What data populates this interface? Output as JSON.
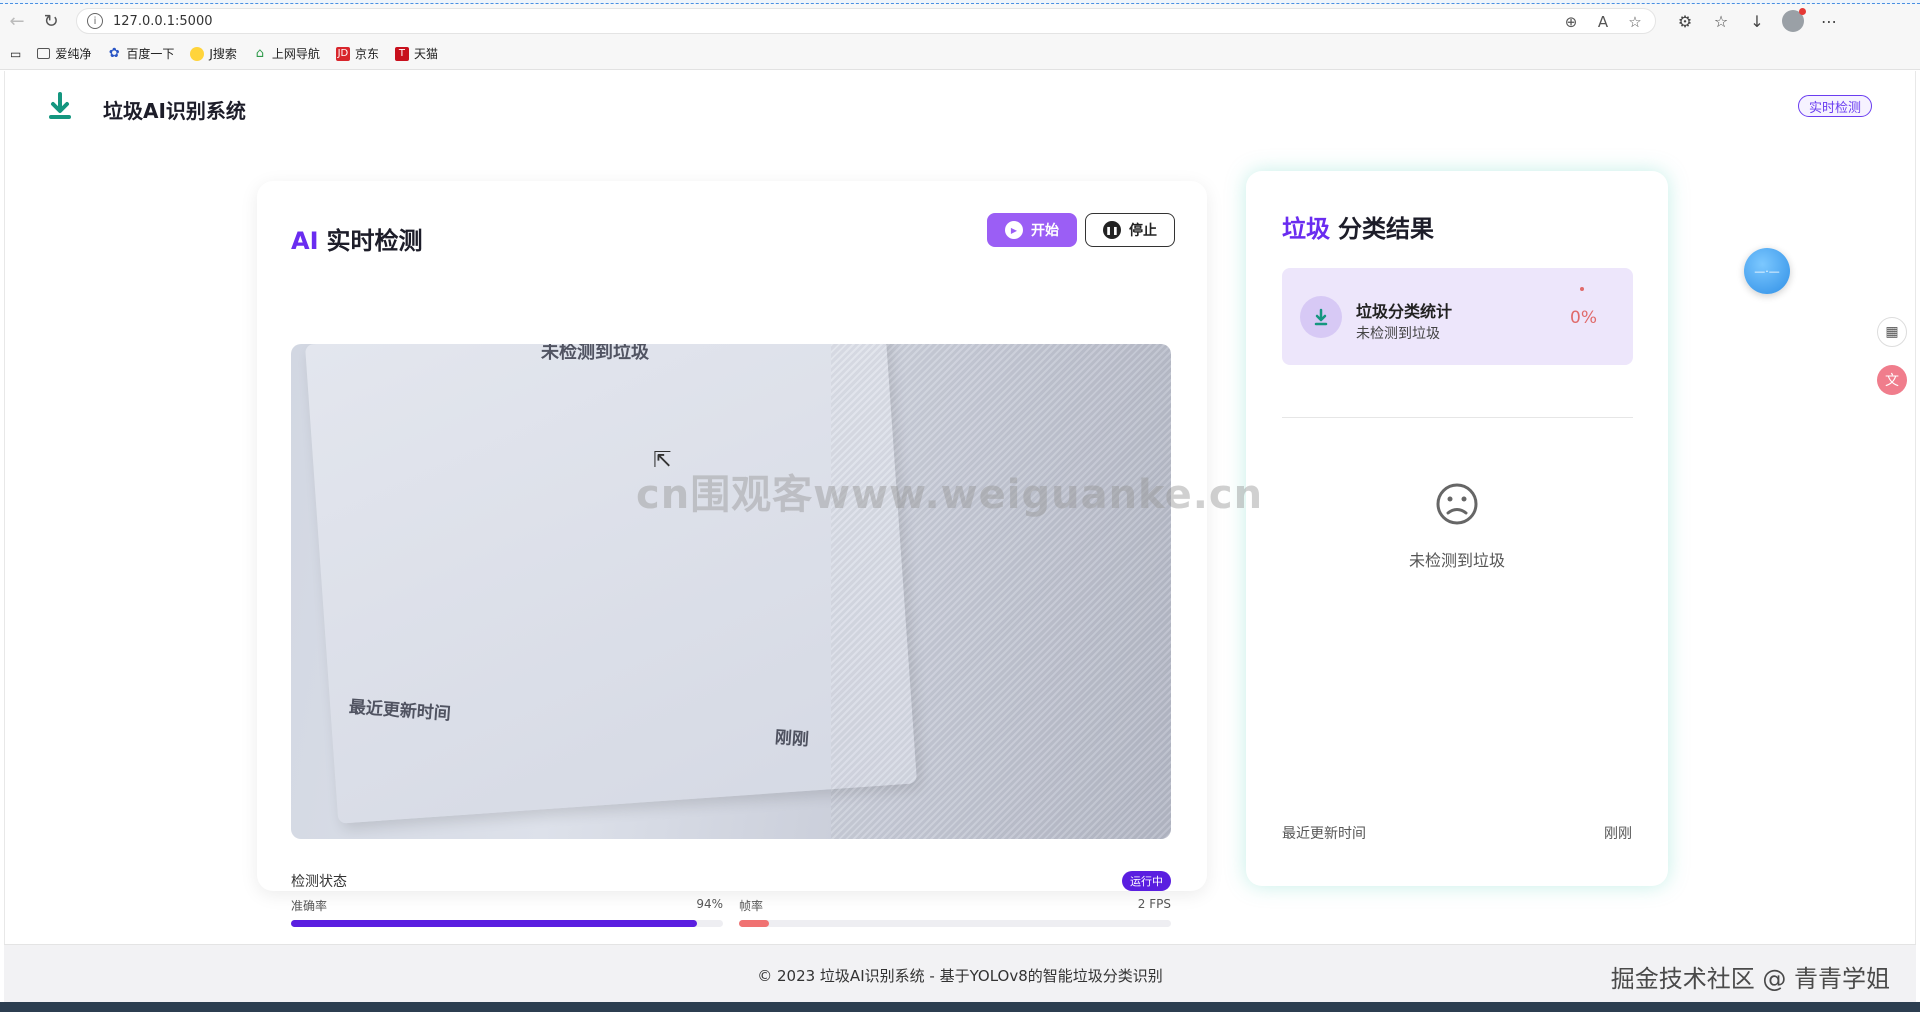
{
  "browser": {
    "url": "127.0.0.1:5000",
    "bookmarks": [
      {
        "label": "爱纯净",
        "icon": "folder-icon"
      },
      {
        "label": "百度一下",
        "icon": "baidu-icon"
      },
      {
        "label": "J搜索",
        "icon": "search-logo-icon"
      },
      {
        "label": "上网导航",
        "icon": "navigation-icon"
      },
      {
        "label": "京东",
        "icon": "jd-icon"
      },
      {
        "label": "天猫",
        "icon": "tmall-icon"
      }
    ]
  },
  "header": {
    "title": "垃圾AI识别系统",
    "badge": "实时检测"
  },
  "detection": {
    "title_accent": "AI",
    "title": "实时检测",
    "start_label": "开始",
    "stop_label": "停止",
    "video_text_top": "未检测到垃圾",
    "video_text_left": "最近更新时间",
    "video_text_right": "刚刚",
    "status_label": "检测状态",
    "status_badge": "运行中",
    "accuracy_label": "准确率",
    "accuracy_value": "94%",
    "accuracy_fraction": 0.94,
    "fps_label": "帧率",
    "fps_value": "2 FPS",
    "fps_fraction": 0.07
  },
  "result": {
    "title_accent": "垃圾",
    "title": "分类结果",
    "stats_title": "垃圾分类统计",
    "stats_sub": "未检测到垃圾",
    "stats_percent": "0%",
    "empty_text": "未检测到垃圾",
    "update_label": "最近更新时间",
    "update_value": "刚刚"
  },
  "watermark": "cn围观客www.weiguanke.cn",
  "footer": {
    "text": "© 2023 垃圾AI识别系统 - 基于YOLOv8的智能垃圾分类识别",
    "credit": "掘金技术社区 @ 青青学姐"
  },
  "colors": {
    "accent": "#6a2cf0",
    "start_button": "#9b5ef5",
    "accuracy_bar": "#5a1ee0",
    "fps_bar": "#f07272",
    "result_glow": "#5ad2be"
  }
}
